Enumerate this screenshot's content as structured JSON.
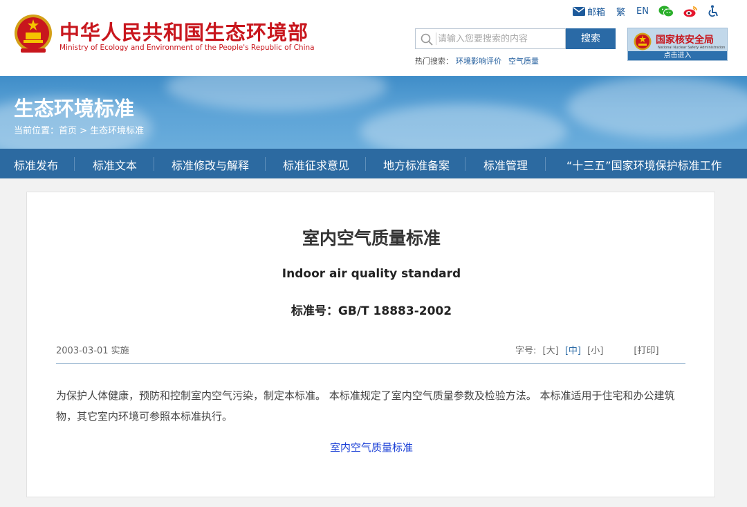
{
  "header": {
    "site_title_cn": "中华人民共和国生态环境部",
    "site_title_en": "Ministry of Ecology and Environment of the People's Republic of China",
    "top_links": {
      "mail": "邮箱",
      "traditional": "繁",
      "english": "EN"
    },
    "search": {
      "placeholder": "请输入您要搜索的内容",
      "button": "搜索"
    },
    "hot_search": {
      "label": "热门搜索：",
      "items": [
        "环境影响评价",
        "空气质量"
      ]
    },
    "nnsa": {
      "name_cn": "国家核安全局",
      "name_en": "National Nuclear Safety Administration",
      "enter": "点击进入"
    }
  },
  "banner": {
    "title": "生态环境标准",
    "breadcrumb": "当前位置：首页 > 生态环境标准"
  },
  "nav": [
    "标准发布",
    "标准文本",
    "标准修改与解释",
    "标准征求意见",
    "地方标准备案",
    "标准管理",
    "“十三五”国家环境保护标准工作"
  ],
  "article": {
    "title_cn": "室内空气质量标准",
    "title_en": "Indoor air quality standard",
    "standard_no": "标准号：GB/T 18883-2002",
    "date": "2003-03-01 实施",
    "font_size": {
      "label": "字号:",
      "large": "[大]",
      "medium": "[中]",
      "small": "[小]",
      "print": "[打印]"
    },
    "body": "为保护人体健康，预防和控制室内空气污染，制定本标准。 本标准规定了室内空气质量参数及检验方法。 本标准适用于住宅和办公建筑物，其它室内环境可参照本标准执行。",
    "attachment_link": "室内空气质量标准"
  },
  "colors": {
    "brand_red": "#c8161d",
    "nav_blue": "#2c6aa1",
    "link_blue": "#1a3fd6"
  }
}
